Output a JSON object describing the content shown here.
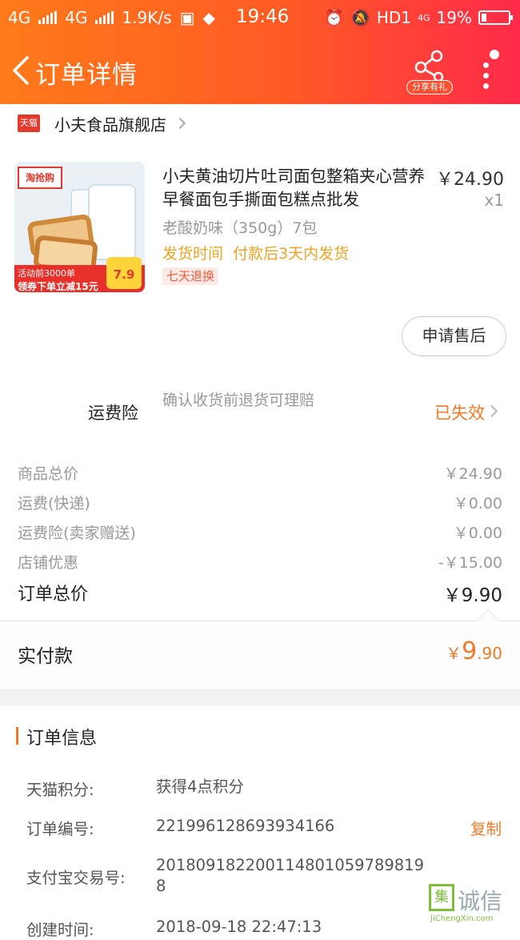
{
  "status_bar": {
    "network1": "4G",
    "network2": "4G",
    "speed": "1.9K/s",
    "time": "19:46",
    "hd": "HD1",
    "lte": "4G",
    "battery": "19%",
    "battery_level": 0.19
  },
  "nav": {
    "title": "订单详情",
    "share_label": "分享有礼"
  },
  "shop": {
    "badge": "天猫",
    "name": "小夫食品旗舰店"
  },
  "product": {
    "title": "小夫黄油切片吐司面包整箱夹心营养早餐面包手撕面包糕点批发",
    "price": "￥24.90",
    "qty": "x1",
    "sku": "老酸奶味（350g）7包",
    "ship_label": "发货时间",
    "ship_value": "付款后3天内发货",
    "tag": "七天退换",
    "thumb_logo": "淘抢购",
    "thumb_promo1": "活动前3000单",
    "thumb_promo2": "领券下单立减15元",
    "thumb_price": "7.9"
  },
  "after_sale_button": "申请售后",
  "insurance": {
    "label": "运费险",
    "desc": "确认收货前退货可理赔",
    "status": "已失效"
  },
  "costs": [
    {
      "label": "商品总价",
      "value": "￥24.90"
    },
    {
      "label": "运费(快递)",
      "value": "￥0.00"
    },
    {
      "label": "运费险(卖家赠送)",
      "value": "￥0.00"
    },
    {
      "label": "店铺优惠",
      "value": "-￥15.00"
    }
  ],
  "total": {
    "label": "订单总价",
    "value": "￥9.90"
  },
  "paid": {
    "label": "实付款",
    "currency": "￥",
    "integer": "9",
    "decimal": ".90"
  },
  "order_info": {
    "heading": "订单信息",
    "rows": [
      {
        "key": "天猫积分:",
        "value": "获得4点积分",
        "action": ""
      },
      {
        "key": "订单编号:",
        "value": "221996128693934166",
        "action": "复制"
      },
      {
        "key": "支付宝交易号:",
        "value": "2018091822001148010597898198",
        "action": ""
      },
      {
        "key": "创建时间:",
        "value": "2018-09-18 22:47:13",
        "action": ""
      }
    ]
  },
  "watermark": {
    "box": "集",
    "text": "诚信",
    "url": "JiChengXin.com"
  }
}
